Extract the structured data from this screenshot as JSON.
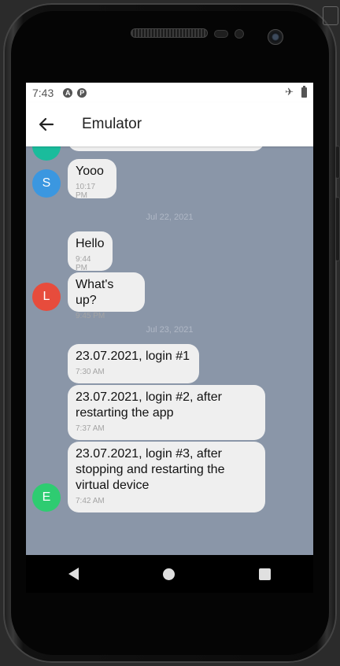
{
  "status_bar": {
    "time": "7:43",
    "app_icons": [
      "A",
      "P"
    ]
  },
  "app_bar": {
    "title": "Emulator",
    "back_icon": "arrow-left-icon"
  },
  "colors": {
    "chat_background": "#8a96a8",
    "bubble": "#efefef",
    "avatar_s": "#3b97e0",
    "avatar_l": "#e74c3c",
    "avatar_e": "#2ecc71"
  },
  "chat": {
    "messages_top": [
      {
        "text": "Yooo",
        "time": "10:17 PM",
        "avatar": "S"
      }
    ],
    "date_1": "Jul 22, 2021",
    "messages_jul22": [
      {
        "text": "Hello",
        "time": "9:44 PM"
      },
      {
        "text": "What's up?",
        "time": "9:45 PM",
        "avatar": "L"
      }
    ],
    "date_2": "Jul 23, 2021",
    "messages_jul23": [
      {
        "text": "23.07.2021, login #1",
        "time": "7:30 AM"
      },
      {
        "text": "23.07.2021, login #2, after\nrestarting the app",
        "time": "7:37 AM"
      },
      {
        "text": "23.07.2021, login #3, after\nstopping and restarting the\nvirtual device",
        "time": "7:42 AM",
        "avatar": "E"
      }
    ]
  },
  "nav_bar": {
    "back": "triangle-back-icon",
    "home": "circle-home-icon",
    "recents": "square-recents-icon"
  }
}
